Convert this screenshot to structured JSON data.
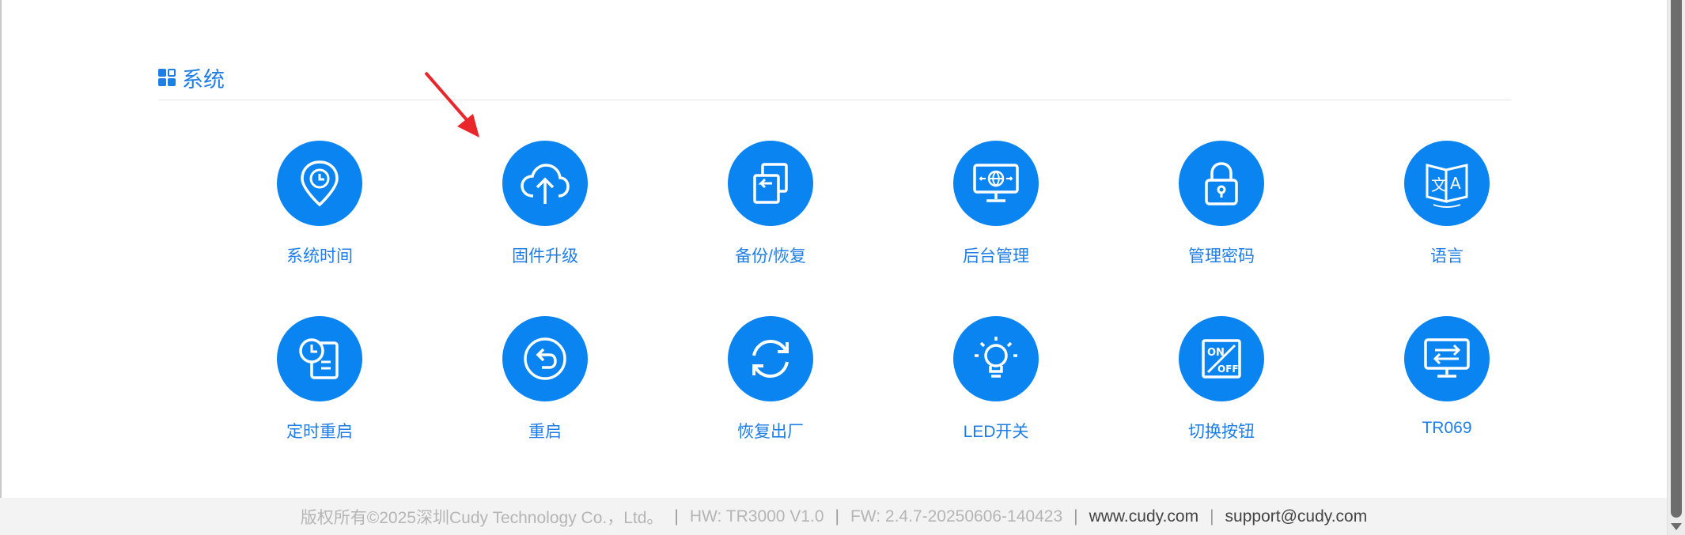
{
  "section": {
    "title": "系统",
    "icon": "grid-icon"
  },
  "tiles": [
    {
      "label": "系统时间",
      "icon": "location-clock-icon"
    },
    {
      "label": "固件升级",
      "icon": "cloud-upload-icon"
    },
    {
      "label": "备份/恢复",
      "icon": "backup-restore-icon"
    },
    {
      "label": "后台管理",
      "icon": "monitor-globe-icon"
    },
    {
      "label": "管理密码",
      "icon": "lock-icon"
    },
    {
      "label": "语言",
      "icon": "translate-icon"
    },
    {
      "label": "定时重启",
      "icon": "clock-schedule-icon"
    },
    {
      "label": "重启",
      "icon": "restart-icon"
    },
    {
      "label": "恢复出厂",
      "icon": "refresh-icon"
    },
    {
      "label": "LED开关",
      "icon": "light-bulb-icon"
    },
    {
      "label": "切换按钮",
      "icon": "on-off-switch-icon"
    },
    {
      "label": "TR069",
      "icon": "monitor-arrows-icon"
    }
  ],
  "footer": {
    "copyright": "版权所有©2025深圳Cudy Technology Co.，Ltd。",
    "hw": "HW: TR3000 V1.0",
    "fw": "FW: 2.4.7-20250606-140423",
    "website": "www.cudy.com",
    "email": "support@cudy.com",
    "separator": "|"
  },
  "colors": {
    "accent": "#0a84f0",
    "label": "#1f7ee6",
    "annotation": "#e8262b"
  }
}
